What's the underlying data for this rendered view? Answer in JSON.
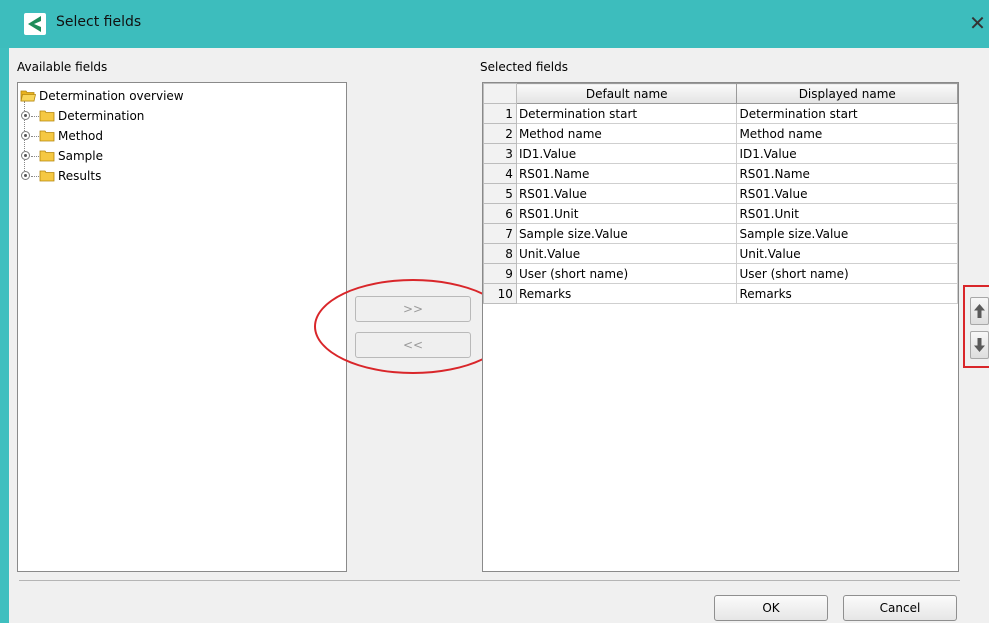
{
  "window": {
    "title": "Select fields",
    "close_symbol": "✕"
  },
  "available": {
    "label": "Available fields",
    "root": "Determination overview",
    "children": [
      "Determination",
      "Method",
      "Sample",
      "Results"
    ]
  },
  "move": {
    "add_label": ">>",
    "remove_label": "<<"
  },
  "selected": {
    "label": "Selected fields",
    "columns": [
      "",
      "Default name",
      "Displayed name"
    ],
    "rows": [
      {
        "num": "1",
        "default": "Determination start",
        "display": "Determination start"
      },
      {
        "num": "2",
        "default": "Method name",
        "display": "Method name"
      },
      {
        "num": "3",
        "default": "ID1.Value",
        "display": "ID1.Value"
      },
      {
        "num": "4",
        "default": "RS01.Name",
        "display": "RS01.Name"
      },
      {
        "num": "5",
        "default": "RS01.Value",
        "display": "RS01.Value"
      },
      {
        "num": "6",
        "default": "RS01.Unit",
        "display": "RS01.Unit"
      },
      {
        "num": "7",
        "default": "Sample size.Value",
        "display": "Sample size.Value"
      },
      {
        "num": "8",
        "default": "Unit.Value",
        "display": "Unit.Value"
      },
      {
        "num": "9",
        "default": "User (short name)",
        "display": "User (short name)"
      },
      {
        "num": "10",
        "default": "Remarks",
        "display": "Remarks"
      }
    ]
  },
  "order": {
    "up_icon": "arrow-up-icon",
    "down_icon": "arrow-down-icon"
  },
  "buttons": {
    "ok": "OK",
    "cancel": "Cancel"
  },
  "colors": {
    "titlebar": "#3dbdbd",
    "highlight": "#d9262a",
    "folder": "#f5c842"
  }
}
